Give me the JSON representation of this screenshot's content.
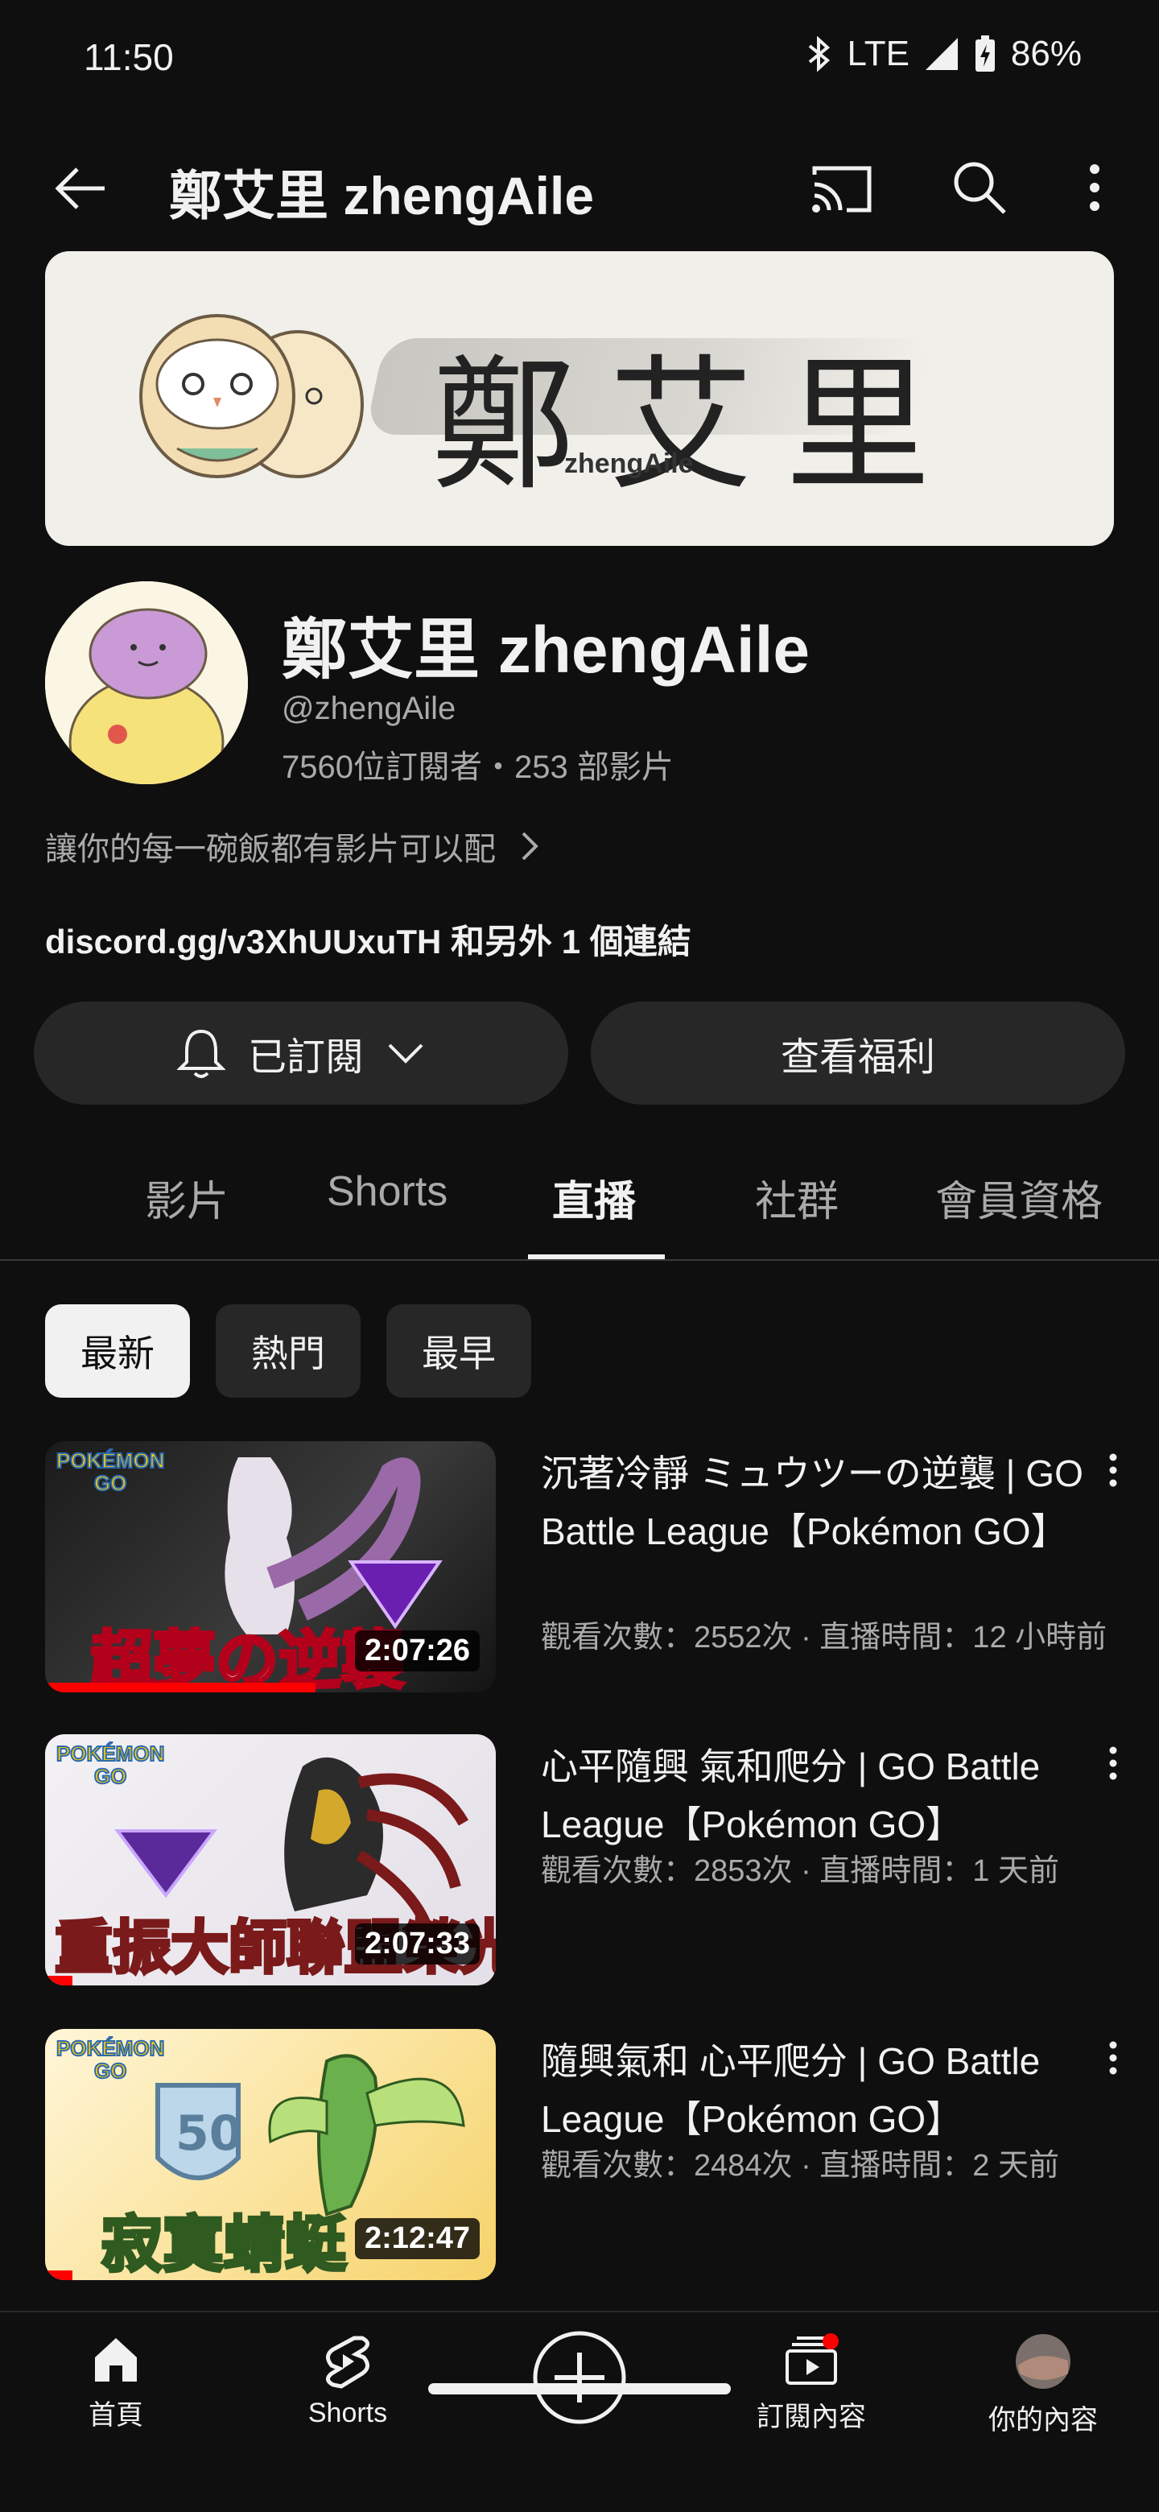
{
  "status_bar": {
    "time": "11:50",
    "network": "LTE",
    "battery": "86%",
    "icons": [
      "bluetooth-icon",
      "signal-icon",
      "battery-charging-icon"
    ]
  },
  "top_bar": {
    "title": "鄭艾里 zhengAile",
    "icons": [
      "back-arrow-icon",
      "cast-icon",
      "search-icon",
      "more-vert-icon"
    ]
  },
  "banner": {
    "name": "鄭艾里",
    "handle": "zhengAile"
  },
  "channel": {
    "name": "鄭艾里 zhengAile",
    "handle": "@zhengAile",
    "stats": "7560位訂閱者・253 部影片",
    "description": "讓你的每一碗飯都有影片可以配",
    "link": "discord.gg/v3XhUUxuTH 和另外 1 個連結"
  },
  "buttons": {
    "subscribed": "已訂閱",
    "perks": "查看福利"
  },
  "tabs": [
    {
      "label": "影片",
      "active": false
    },
    {
      "label": "Shorts",
      "active": false
    },
    {
      "label": "直播",
      "active": true
    },
    {
      "label": "社群",
      "active": false
    },
    {
      "label": "會員資格",
      "active": false
    }
  ],
  "chips": [
    {
      "label": "最新",
      "selected": true
    },
    {
      "label": "熱門",
      "selected": false
    },
    {
      "label": "最早",
      "selected": false
    }
  ],
  "videos": [
    {
      "title": "沉著冷靜 ミュウツーの逆襲 | GO Battle League【Pokémon GO】",
      "meta": "觀看次數：2552次 · 直播時間：12 小時前",
      "duration": "2:07:26",
      "overlay": "超夢の逆襲",
      "progress": 0.6
    },
    {
      "title": "心平隨興 氣和爬分 | GO Battle League【Pokémon GO】",
      "meta": "觀看次數：2853次 · 直播時間：1 天前",
      "duration": "2:07:33",
      "overlay": "重振大師聯盟榮光",
      "progress": 0.06
    },
    {
      "title": "隨興氣和 心平爬分 | GO Battle League【Pokémon GO】",
      "meta": "觀看次數：2484次 · 直播時間：2 天前",
      "duration": "2:12:47",
      "overlay": "寂寞蜻蜓",
      "progress": 0.06
    }
  ],
  "bottom_nav": {
    "items": [
      {
        "label": "首頁",
        "icon": "home-icon"
      },
      {
        "label": "Shorts",
        "icon": "shorts-icon"
      },
      {
        "label": "",
        "icon": "create-icon"
      },
      {
        "label": "訂閱內容",
        "icon": "subscriptions-icon"
      },
      {
        "label": "你的內容",
        "icon": "avatar-icon"
      }
    ]
  },
  "colors": {
    "background": "#0f0f0f",
    "surface": "#272727",
    "text_primary": "#f1f1f1",
    "text_secondary": "#aaaaaa",
    "accent_red": "#ff0000"
  }
}
